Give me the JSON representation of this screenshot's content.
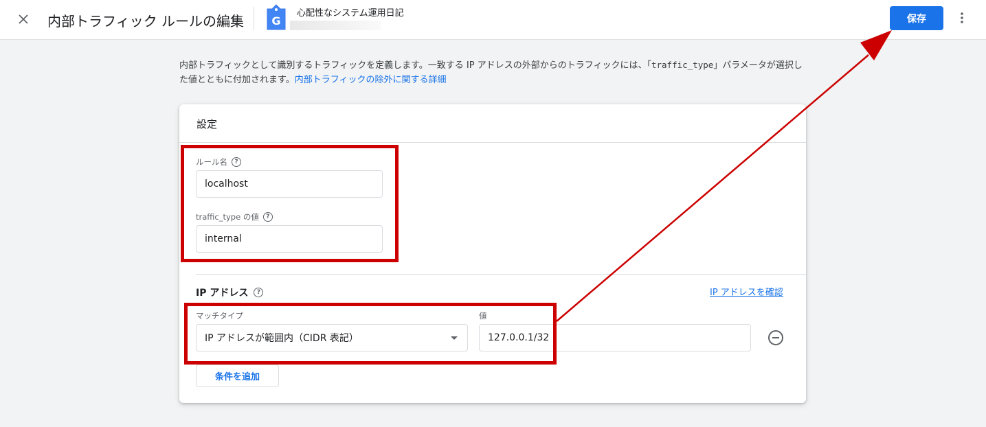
{
  "header": {
    "title": "内部トラフィック ルールの編集",
    "property_name": "心配性なシステム運用日記",
    "save_label": "保存",
    "property_icon_letter": "G"
  },
  "intro": {
    "text_1": "内部トラフィックとして識別するトラフィックを定義します。一致する IP アドレスの外部からのトラフィックには、「",
    "param": "traffic_type",
    "text_2": "」パラメータが選択した値とともに付加されます。",
    "link": "内部トラフィックの除外に関する詳細"
  },
  "settings": {
    "title": "設定",
    "rule_name_label": "ルール名",
    "rule_name_value": "localhost",
    "traffic_type_label": "traffic_type の値",
    "traffic_type_value": "internal"
  },
  "ip": {
    "heading": "IP アドレス",
    "check_link": "IP アドレスを確認",
    "match_type_label": "マッチタイプ",
    "match_type_value": "IP アドレスが範囲内（CIDR 表記）",
    "value_label": "値",
    "value": "127.0.0.1/32",
    "add_condition_label": "条件を追加"
  },
  "colors": {
    "accent": "#1a73e8",
    "annotation_red": "#cc0000"
  }
}
